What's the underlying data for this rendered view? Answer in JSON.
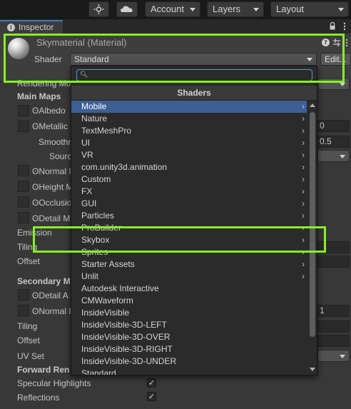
{
  "toolbar": {
    "account_label": "Account",
    "layers_label": "Layers",
    "layout_label": "Layout",
    "collab_icon": "collab-icon",
    "cloud_icon": "cloud-icon"
  },
  "inspector": {
    "tab_label": "Inspector",
    "lock_icon": "lock-icon",
    "menu_icon": "kebab-menu-icon"
  },
  "material": {
    "title": "Skymaterial (Material)",
    "shader_label": "Shader",
    "shader_value": "Standard",
    "edit_label": "Edit...",
    "help_icon": "help-icon",
    "settings_icon": "preset-icon"
  },
  "properties": {
    "rendering_mode": "Rendering Mo",
    "main_maps": "Main Maps",
    "albedo": "Albedo",
    "metallic": "Metallic",
    "smoothness": "Smoothn",
    "source": "Sourc",
    "normal_map": "Normal I",
    "height_map": "Height M",
    "occlusion": "Occlusio",
    "detail_mask": "Detail M",
    "emission": "Emission",
    "tiling": "Tiling",
    "offset": "Offset",
    "secondary_maps": "Secondary M",
    "detail_albedo": "Detail A",
    "normal_map_2": "Normal I",
    "tiling_2": "Tiling",
    "offset_2": "Offset",
    "uv_set": "UV Set",
    "forward_rendering": "Forward Ren",
    "specular_highlights": "Specular Highlights",
    "reflections": "Reflections",
    "metallic_value": "0",
    "smoothness_value": "0.5",
    "normal_scale_value": "1",
    "check_mark": "✓"
  },
  "shader_popup": {
    "search_placeholder": "",
    "heading": "Shaders",
    "items": [
      {
        "label": "Mobile",
        "submenu": true,
        "selected": true
      },
      {
        "label": "Nature",
        "submenu": true
      },
      {
        "label": "TextMeshPro",
        "submenu": true
      },
      {
        "label": "UI",
        "submenu": true
      },
      {
        "label": "VR",
        "submenu": true
      },
      {
        "label": "com.unity3d.animation",
        "submenu": true
      },
      {
        "label": "Custom",
        "submenu": true
      },
      {
        "label": "FX",
        "submenu": true
      },
      {
        "label": "GUI",
        "submenu": true
      },
      {
        "label": "Particles",
        "submenu": true
      },
      {
        "label": "ProBuilder",
        "submenu": true
      },
      {
        "label": "Skybox",
        "submenu": true
      },
      {
        "label": "Sprites",
        "submenu": true
      },
      {
        "label": "Starter Assets",
        "submenu": true
      },
      {
        "label": "Unlit",
        "submenu": true
      },
      {
        "label": "Autodesk Interactive",
        "submenu": false
      },
      {
        "label": "CMWaveform",
        "submenu": false
      },
      {
        "label": "InsideVisible",
        "submenu": false
      },
      {
        "label": "InsideVisible-3D-LEFT",
        "submenu": false
      },
      {
        "label": "InsideVisible-3D-OVER",
        "submenu": false
      },
      {
        "label": "InsideVisible-3D-RIGHT",
        "submenu": false
      },
      {
        "label": "InsideVisible-3D-UNDER",
        "submenu": false
      },
      {
        "label": "Standard",
        "submenu": false
      }
    ]
  },
  "colors": {
    "highlight_box": "#85f024",
    "selected_row": "#3d5f96",
    "accent": "#3a79bb"
  }
}
